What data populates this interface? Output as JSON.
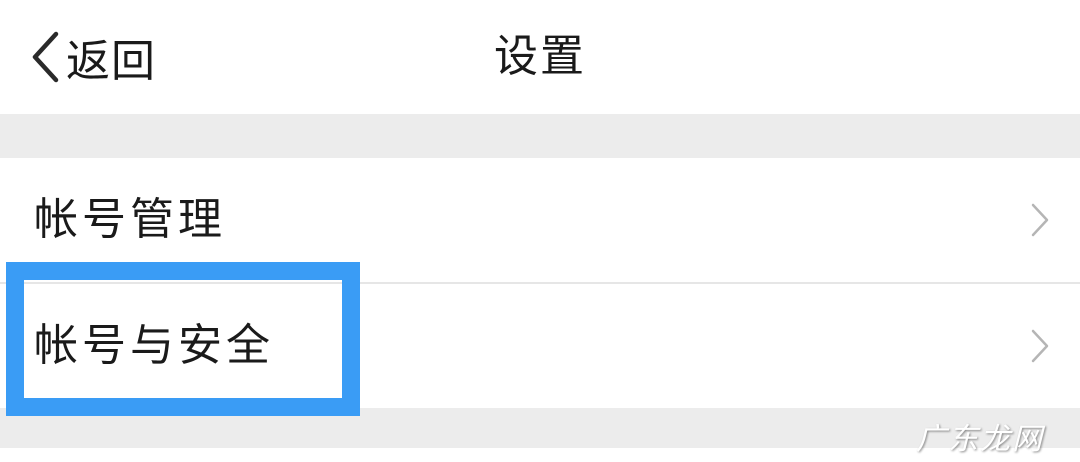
{
  "navbar": {
    "back_label": "返回",
    "title": "设置",
    "back_icon": "chevron-left-icon"
  },
  "list": {
    "items": [
      {
        "label": "帐号管理",
        "icon": "chevron-right-icon"
      },
      {
        "label": "帐号与安全",
        "icon": "chevron-right-icon"
      }
    ]
  },
  "highlight": {
    "color": "#3a9cf5",
    "target": "帐号与安全"
  },
  "watermark": {
    "text": "广东龙网"
  },
  "colors": {
    "background": "#ececec",
    "surface": "#ffffff",
    "text": "#1a1a1a",
    "chevron": "#b5b5b5",
    "accent": "#3a9cf5"
  }
}
